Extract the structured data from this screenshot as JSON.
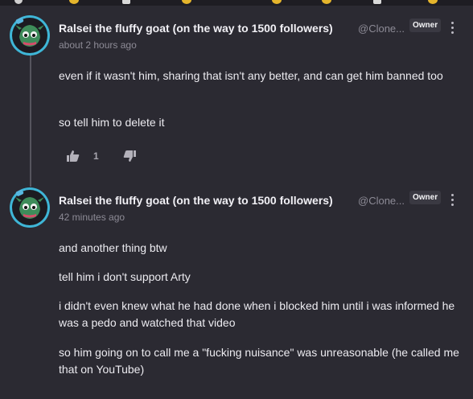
{
  "comments": [
    {
      "author": "Ralsei the fluffy goat (on the way to 1500 followers)",
      "handle": "@Clone...",
      "badge": "Owner",
      "time": "about 2 hours ago",
      "paragraphs": [
        "even if it wasn't him, sharing that isn't any better, and can get him banned too",
        "so tell him to delete it"
      ],
      "upvotes": "1"
    },
    {
      "author": "Ralsei the fluffy goat (on the way to 1500 followers)",
      "handle": "@Clone...",
      "badge": "Owner",
      "time": "42 minutes ago",
      "paragraphs": [
        "and another thing btw",
        "tell him i don't support Arty",
        "i didn't even knew what he had done when i blocked him until i was informed he was a pedo and watched that video",
        "so him going on to call me a \"fucking nuisance\" was unreasonable (he called me that on YouTube)"
      ]
    }
  ],
  "icons": {
    "avatar": "goat-avatar-icon",
    "kebab": "more-vertical-icon",
    "upvote": "thumbs-up-icon",
    "downvote": "thumbs-down-icon"
  },
  "colors": {
    "background": "#2b2a32",
    "avatar_ring": "#3fb6d7",
    "muted_text": "#8d8b96",
    "badge_bg": "#3a3942"
  }
}
